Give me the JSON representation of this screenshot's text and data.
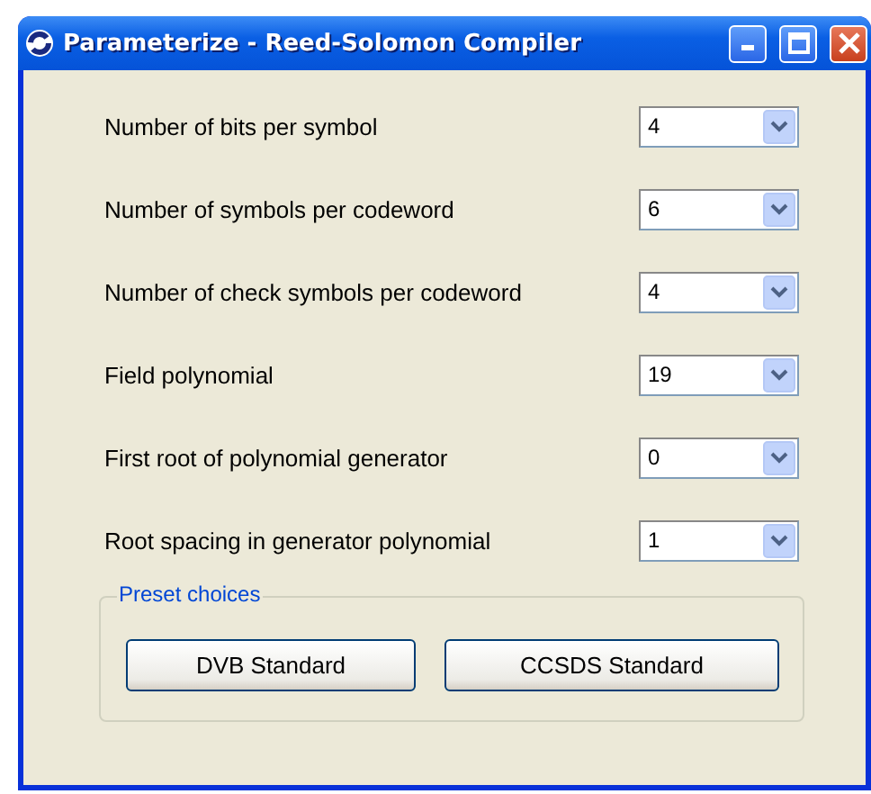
{
  "window": {
    "title": "Parameterize - Reed-Solomon Compiler"
  },
  "fields": [
    {
      "label": "Number of bits per symbol",
      "value": "4"
    },
    {
      "label": "Number of symbols per codeword",
      "value": "6"
    },
    {
      "label": "Number of check symbols per codeword",
      "value": "4"
    },
    {
      "label": "Field polynomial",
      "value": "19"
    },
    {
      "label": "First root of polynomial generator",
      "value": "0"
    },
    {
      "label": "Root spacing in generator polynomial",
      "value": "1"
    }
  ],
  "preset_group": {
    "title": "Preset choices",
    "buttons": [
      "DVB Standard",
      "CCSDS Standard"
    ]
  }
}
